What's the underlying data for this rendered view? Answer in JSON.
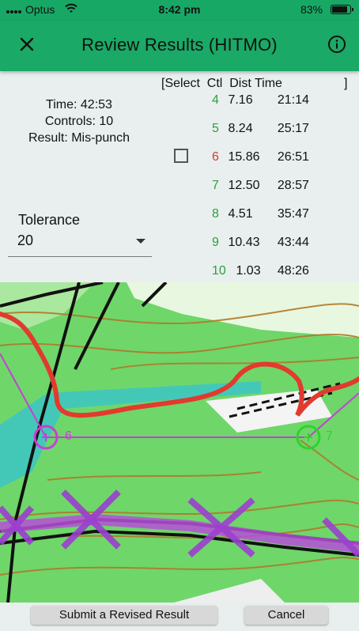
{
  "status": {
    "carrier": "Optus",
    "time": "8:42 pm",
    "battery": "83%",
    "battery_level": 0.83
  },
  "appbar": {
    "title": "Review Results (HITMO)",
    "close_icon": "close-icon",
    "info_icon": "info-icon"
  },
  "summary": {
    "time": "Time: 42:53",
    "controls": "Controls: 10",
    "result": "Result: Mis-punch"
  },
  "tolerance": {
    "label": "Tolerance",
    "value": "20"
  },
  "table": {
    "header": "[Select  Ctl  Dist Time",
    "header_end": "]",
    "rows": [
      {
        "ctl": "4",
        "dist": "7.16",
        "time": "21:14",
        "status": "ok"
      },
      {
        "ctl": "5",
        "dist": "8.24",
        "time": "25:17",
        "status": "ok"
      },
      {
        "ctl": "6",
        "dist": "15.86",
        "time": "26:51",
        "status": "mispunch"
      },
      {
        "ctl": "7",
        "dist": "12.50",
        "time": "28:57",
        "status": "ok"
      },
      {
        "ctl": "8",
        "dist": "4.51",
        "time": "35:47",
        "status": "ok"
      },
      {
        "ctl": "9",
        "dist": "10.43",
        "time": "43:44",
        "status": "ok"
      },
      {
        "ctl": "10",
        "dist": "1.03",
        "time": "48:26",
        "status": "ok"
      }
    ]
  },
  "map": {
    "control_a": "6",
    "control_b": "7"
  },
  "buttons": {
    "submit": "Submit a Revised Result",
    "cancel": "Cancel"
  },
  "colors": {
    "appbar": "#1aa966",
    "ok": "#2f9e3b",
    "mispunch": "#d43b2f",
    "route": "#e23a2e",
    "course": "#c83fd6"
  }
}
